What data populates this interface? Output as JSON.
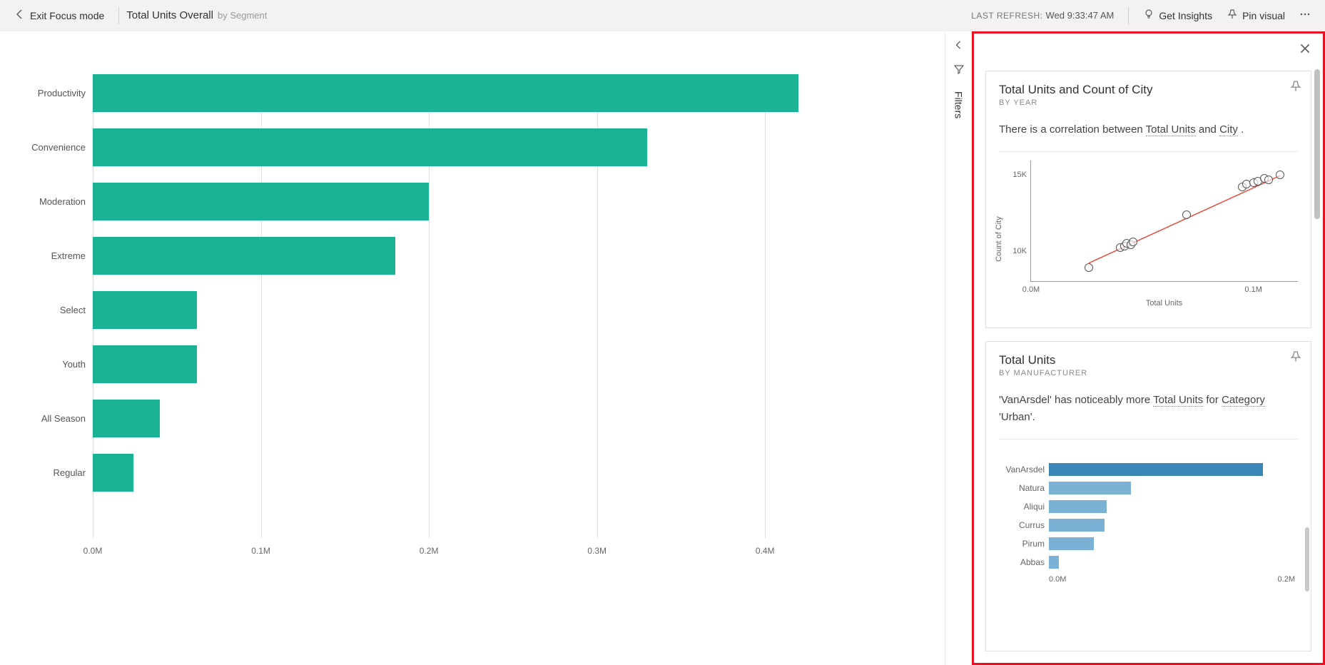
{
  "topbar": {
    "exit_label": "Exit Focus mode",
    "title": "Total Units Overall",
    "subtitle": "by Segment",
    "refresh_label": "LAST REFRESH:",
    "refresh_time": "Wed 9:33:47 AM",
    "get_insights": "Get Insights",
    "pin_visual": "Pin visual"
  },
  "filters": {
    "label": "Filters"
  },
  "chart_data": {
    "type": "bar",
    "orientation": "horizontal",
    "title": "Total Units Overall by Segment",
    "xlabel": "",
    "ylabel": "",
    "xlim": [
      0,
      450000
    ],
    "ticks": [
      0,
      100000,
      200000,
      300000,
      400000
    ],
    "tick_labels": [
      "0.0M",
      "0.1M",
      "0.2M",
      "0.3M",
      "0.4M"
    ],
    "categories": [
      "Productivity",
      "Convenience",
      "Moderation",
      "Extreme",
      "Select",
      "Youth",
      "All Season",
      "Regular"
    ],
    "values": [
      420000,
      330000,
      200000,
      180000,
      62000,
      62000,
      40000,
      24000
    ],
    "bar_color": "#1ab394"
  },
  "insights": {
    "card1": {
      "title": "Total Units and Count of City",
      "subtitle": "BY YEAR",
      "desc_pre": "There is a correlation between ",
      "desc_u1": "Total Units",
      "desc_mid": " and ",
      "desc_u2": "City",
      "desc_post": " .",
      "scatter": {
        "type": "scatter",
        "xlabel": "Total Units",
        "ylabel": "Count of City",
        "xticks": [
          0,
          100000
        ],
        "xtick_labels": [
          "0.0M",
          "0.1M"
        ],
        "yticks": [
          10000,
          15000
        ],
        "ytick_labels": [
          "10K",
          "15K"
        ],
        "points": [
          {
            "x": 26000,
            "y": 8900
          },
          {
            "x": 40000,
            "y": 10200
          },
          {
            "x": 42000,
            "y": 10300
          },
          {
            "x": 43000,
            "y": 10500
          },
          {
            "x": 45000,
            "y": 10400
          },
          {
            "x": 46000,
            "y": 10600
          },
          {
            "x": 70000,
            "y": 12400
          },
          {
            "x": 95000,
            "y": 14200
          },
          {
            "x": 97000,
            "y": 14400
          },
          {
            "x": 100000,
            "y": 14500
          },
          {
            "x": 102000,
            "y": 14600
          },
          {
            "x": 105000,
            "y": 14800
          },
          {
            "x": 107000,
            "y": 14700
          },
          {
            "x": 112000,
            "y": 15000
          }
        ],
        "trend": {
          "x1": 26000,
          "y1": 9200,
          "x2": 112000,
          "y2": 15000
        }
      }
    },
    "card2": {
      "title": "Total Units",
      "subtitle": "BY MANUFACTURER",
      "desc_pre": "'VanArsdel' has noticeably more ",
      "desc_u1": "Total Units",
      "desc_mid": " for ",
      "desc_u2": "Category",
      "desc_post": " 'Urban'.",
      "bars": {
        "type": "bar",
        "orientation": "horizontal",
        "categories": [
          "VanArsdel",
          "Natura",
          "Aliqui",
          "Currus",
          "Pirum",
          "Abbas"
        ],
        "values": [
          260000,
          100000,
          70000,
          68000,
          55000,
          12000
        ],
        "xlim": [
          0,
          260000
        ],
        "tick_labels": [
          "0.0M",
          "0.2M"
        ],
        "highlight_index": 0
      }
    }
  }
}
